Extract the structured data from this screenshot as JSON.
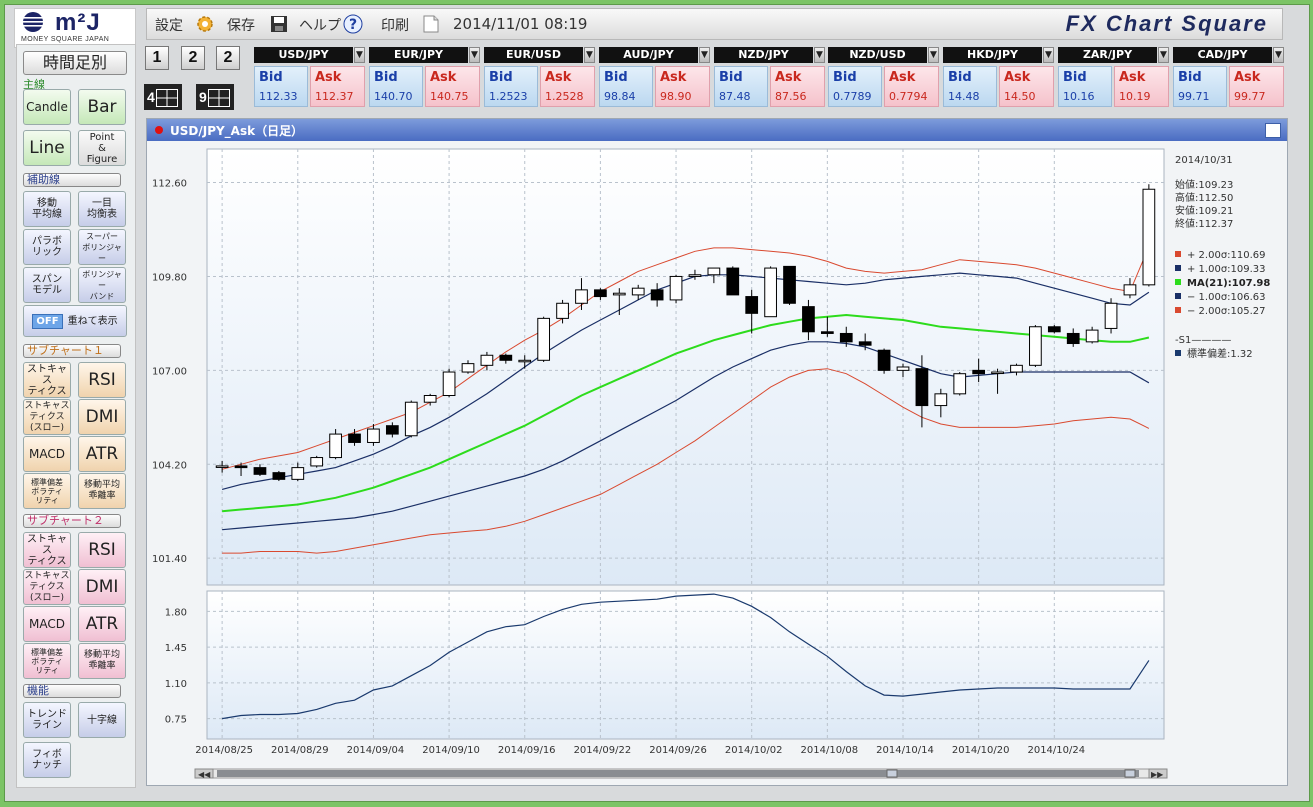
{
  "logo": {
    "brand": "m²J",
    "sub": "MONEY SQUARE JAPAN"
  },
  "toolbar": {
    "settings": "設定",
    "save": "保存",
    "help": "ヘルプ",
    "print": "印刷",
    "datetime": "2014/11/01 08:19",
    "brand": "FX Chart Square"
  },
  "layout_buttons": {
    "b1": "1",
    "b2": "2",
    "b3": "2",
    "b4": "4",
    "b9": "9"
  },
  "quotes": [
    {
      "pair": "USD/JPY",
      "bid_label": "Bid",
      "ask_label": "Ask",
      "bid": "112.33",
      "ask": "112.37"
    },
    {
      "pair": "EUR/JPY",
      "bid_label": "Bid",
      "ask_label": "Ask",
      "bid": "140.70",
      "ask": "140.75"
    },
    {
      "pair": "EUR/USD",
      "bid_label": "Bid",
      "ask_label": "Ask",
      "bid": "1.2523",
      "ask": "1.2528"
    },
    {
      "pair": "AUD/JPY",
      "bid_label": "Bid",
      "ask_label": "Ask",
      "bid": "98.84",
      "ask": "98.90"
    },
    {
      "pair": "NZD/JPY",
      "bid_label": "Bid",
      "ask_label": "Ask",
      "bid": "87.48",
      "ask": "87.56"
    },
    {
      "pair": "NZD/USD",
      "bid_label": "Bid",
      "ask_label": "Ask",
      "bid": "0.7789",
      "ask": "0.7794"
    },
    {
      "pair": "HKD/JPY",
      "bid_label": "Bid",
      "ask_label": "Ask",
      "bid": "14.48",
      "ask": "14.50"
    },
    {
      "pair": "ZAR/JPY",
      "bid_label": "Bid",
      "ask_label": "Ask",
      "bid": "10.16",
      "ask": "10.19"
    },
    {
      "pair": "CAD/JPY",
      "bid_label": "Bid",
      "ask_label": "Ask",
      "bid": "99.71",
      "ask": "99.77"
    }
  ],
  "sidebar": {
    "timeframe": "時間足別",
    "main_label": "主線",
    "candle": "Candle",
    "bar": "Bar",
    "line": "Line",
    "pf_1": "Point",
    "pf_2": "&",
    "pf_3": "Figure",
    "aux_label": "補助線",
    "ma_1": "移動",
    "ma_2": "平均線",
    "ichimoku_1": "一目",
    "ichimoku_2": "均衡表",
    "parabolic_1": "パラボ",
    "parabolic_2": "リック",
    "super_1": "スーパー",
    "super_2": "ボリンジャー",
    "span_1": "スパン",
    "span_2": "モデル",
    "bollinger_1": "ボリンジャー",
    "bollinger_2": "バンド",
    "off_tag": "OFF",
    "overlay": "重ねて表示",
    "sub1_label": "サブチャート１",
    "sub2_label": "サブチャート２",
    "stoch_1": "ストキャス",
    "stoch_2": "ティクス",
    "slow_1": "ストキャス",
    "slow_2": "ティクス",
    "slow_3": "(スロー)",
    "rsi": "RSI",
    "dmi": "DMI",
    "macd": "MACD",
    "atr": "ATR",
    "stdvol_1": "標準偏差",
    "stdvol_2": "ボラティ",
    "stdvol_3": "リティ",
    "madev_1": "移動平均",
    "madev_2": "乖離率",
    "func_label": "機能",
    "trend_1": "トレンド",
    "trend_2": "ライン",
    "crosshair": "十字線",
    "fibo_1": "フィボ",
    "fibo_2": "ナッチ"
  },
  "chart_window": {
    "title": "USD/JPY_Ask（日足）",
    "info": {
      "date": "2014/10/31",
      "open": "始値:109.23",
      "high": "高値:112.50",
      "low": "安値:109.21",
      "close": "終値:112.37",
      "bb_p2": "+ 2.00σ:110.69",
      "bb_p1": "+ 1.00σ:109.33",
      "ma": "MA(21):107.98",
      "bb_m1": "− 1.00σ:106.63",
      "bb_m2": "− 2.00σ:105.27",
      "s1": "-S1————",
      "std": "標準偏差:1.32"
    }
  },
  "colors": {
    "ma": "#2ddc1c",
    "bb_outer": "#d9492f",
    "bb_inner": "#1a2f66",
    "std": "#1a3a6e",
    "bid": "#1a3fa8",
    "ask": "#c9281e"
  },
  "chart_data": {
    "type": "candlestick",
    "main": {
      "y_ticks": [
        "112.60",
        "109.80",
        "107.00",
        "104.20",
        "101.40"
      ],
      "y_tick_values": [
        112.6,
        109.8,
        107.0,
        104.2,
        101.4
      ],
      "ylim": [
        100.6,
        113.6
      ],
      "x_tick_labels": [
        "2014/08/25",
        "2014/08/29",
        "2014/09/04",
        "2014/09/10",
        "2014/09/16",
        "2014/09/22",
        "2014/09/26",
        "2014/10/02",
        "2014/10/08",
        "2014/10/14",
        "2014/10/20",
        "2014/10/24"
      ],
      "x_tick_index": [
        0,
        4,
        8,
        12,
        16,
        20,
        24,
        28,
        32,
        36,
        40,
        44
      ],
      "candles": [
        {
          "o": 104.15,
          "h": 104.3,
          "l": 103.95,
          "c": 104.15
        },
        {
          "o": 104.15,
          "h": 104.25,
          "l": 103.85,
          "c": 104.1
        },
        {
          "o": 104.1,
          "h": 104.2,
          "l": 103.85,
          "c": 103.9
        },
        {
          "o": 103.95,
          "h": 104.0,
          "l": 103.7,
          "c": 103.75
        },
        {
          "o": 103.75,
          "h": 104.25,
          "l": 103.7,
          "c": 104.1
        },
        {
          "o": 104.15,
          "h": 104.45,
          "l": 104.1,
          "c": 104.4
        },
        {
          "o": 104.4,
          "h": 105.25,
          "l": 104.35,
          "c": 105.1
        },
        {
          "o": 105.1,
          "h": 105.25,
          "l": 104.75,
          "c": 104.85
        },
        {
          "o": 104.85,
          "h": 105.4,
          "l": 104.75,
          "c": 105.25
        },
        {
          "o": 105.35,
          "h": 105.45,
          "l": 105.0,
          "c": 105.1
        },
        {
          "o": 105.05,
          "h": 106.1,
          "l": 105.0,
          "c": 106.05
        },
        {
          "o": 106.05,
          "h": 106.3,
          "l": 105.95,
          "c": 106.25
        },
        {
          "o": 106.25,
          "h": 107.05,
          "l": 106.2,
          "c": 106.95
        },
        {
          "o": 106.95,
          "h": 107.3,
          "l": 106.9,
          "c": 107.2
        },
        {
          "o": 107.15,
          "h": 107.55,
          "l": 107.0,
          "c": 107.45
        },
        {
          "o": 107.45,
          "h": 107.5,
          "l": 107.2,
          "c": 107.3
        },
        {
          "o": 107.3,
          "h": 107.45,
          "l": 107.05,
          "c": 107.3
        },
        {
          "o": 107.3,
          "h": 108.6,
          "l": 107.25,
          "c": 108.55
        },
        {
          "o": 108.55,
          "h": 109.1,
          "l": 108.4,
          "c": 109.0
        },
        {
          "o": 109.0,
          "h": 109.75,
          "l": 108.8,
          "c": 109.4
        },
        {
          "o": 109.4,
          "h": 109.45,
          "l": 109.1,
          "c": 109.2
        },
        {
          "o": 109.25,
          "h": 109.45,
          "l": 108.65,
          "c": 109.3
        },
        {
          "o": 109.25,
          "h": 109.55,
          "l": 109.1,
          "c": 109.45
        },
        {
          "o": 109.4,
          "h": 109.6,
          "l": 108.9,
          "c": 109.1
        },
        {
          "o": 109.1,
          "h": 109.85,
          "l": 109.0,
          "c": 109.8
        },
        {
          "o": 109.8,
          "h": 110.0,
          "l": 109.7,
          "c": 109.85
        },
        {
          "o": 109.85,
          "h": 110.05,
          "l": 109.6,
          "c": 110.05
        },
        {
          "o": 110.05,
          "h": 110.1,
          "l": 109.3,
          "c": 109.25
        },
        {
          "o": 109.2,
          "h": 109.4,
          "l": 108.1,
          "c": 108.7
        },
        {
          "o": 108.6,
          "h": 110.1,
          "l": 108.6,
          "c": 110.05
        },
        {
          "o": 110.1,
          "h": 110.1,
          "l": 108.95,
          "c": 109.0
        },
        {
          "o": 108.9,
          "h": 109.1,
          "l": 107.9,
          "c": 108.15
        },
        {
          "o": 108.15,
          "h": 108.6,
          "l": 108.0,
          "c": 108.1
        },
        {
          "o": 108.1,
          "h": 108.3,
          "l": 107.7,
          "c": 107.85
        },
        {
          "o": 107.85,
          "h": 108.1,
          "l": 107.6,
          "c": 107.75
        },
        {
          "o": 107.6,
          "h": 107.65,
          "l": 106.9,
          "c": 107.0
        },
        {
          "o": 107.0,
          "h": 107.2,
          "l": 106.8,
          "c": 107.1
        },
        {
          "o": 107.05,
          "h": 107.45,
          "l": 105.3,
          "c": 105.95
        },
        {
          "o": 105.95,
          "h": 106.45,
          "l": 105.6,
          "c": 106.3
        },
        {
          "o": 106.3,
          "h": 106.95,
          "l": 106.25,
          "c": 106.9
        },
        {
          "o": 107.0,
          "h": 107.35,
          "l": 106.65,
          "c": 106.9
        },
        {
          "o": 106.95,
          "h": 107.05,
          "l": 106.3,
          "c": 106.95
        },
        {
          "o": 106.95,
          "h": 107.2,
          "l": 106.85,
          "c": 107.15
        },
        {
          "o": 107.15,
          "h": 108.35,
          "l": 107.1,
          "c": 108.3
        },
        {
          "o": 108.3,
          "h": 108.35,
          "l": 108.1,
          "c": 108.15
        },
        {
          "o": 108.1,
          "h": 108.25,
          "l": 107.7,
          "c": 107.8
        },
        {
          "o": 107.85,
          "h": 108.3,
          "l": 107.8,
          "c": 108.2
        },
        {
          "o": 108.25,
          "h": 109.15,
          "l": 108.1,
          "c": 109.0
        },
        {
          "o": 109.25,
          "h": 109.75,
          "l": 109.15,
          "c": 109.55
        },
        {
          "o": 109.55,
          "h": 112.55,
          "l": 109.5,
          "c": 112.4
        }
      ],
      "series": [
        {
          "name": "+ 2.00σ",
          "values": [
            104.05,
            104.2,
            104.35,
            104.45,
            104.55,
            104.75,
            104.95,
            105.15,
            105.35,
            105.55,
            105.75,
            106.05,
            106.35,
            106.75,
            107.15,
            107.55,
            107.9,
            108.2,
            108.55,
            108.95,
            109.35,
            109.65,
            109.95,
            110.15,
            110.35,
            110.55,
            110.65,
            110.65,
            110.6,
            110.55,
            110.5,
            110.4,
            110.25,
            110.05,
            109.95,
            109.9,
            109.95,
            110.0,
            110.15,
            110.3,
            110.25,
            110.2,
            110.15,
            110.05,
            109.9,
            109.75,
            109.6,
            109.45,
            109.35,
            110.69
          ]
        },
        {
          "name": "+ 1.00σ",
          "values": [
            103.45,
            103.6,
            103.7,
            103.8,
            103.9,
            104.0,
            104.1,
            104.3,
            104.5,
            104.75,
            105.05,
            105.3,
            105.6,
            105.95,
            106.3,
            106.7,
            107.1,
            107.5,
            107.85,
            108.2,
            108.5,
            108.8,
            109.1,
            109.4,
            109.6,
            109.8,
            109.85,
            109.85,
            109.8,
            109.75,
            109.7,
            109.65,
            109.6,
            109.55,
            109.6,
            109.7,
            109.75,
            109.8,
            109.85,
            109.9,
            109.85,
            109.8,
            109.75,
            109.6,
            109.45,
            109.3,
            109.15,
            109.0,
            108.95,
            109.33
          ]
        },
        {
          "name": "MA(21)",
          "values": [
            102.8,
            102.85,
            102.9,
            102.95,
            103.0,
            103.1,
            103.2,
            103.35,
            103.5,
            103.7,
            103.9,
            104.1,
            104.35,
            104.6,
            104.85,
            105.1,
            105.35,
            105.65,
            105.95,
            106.25,
            106.5,
            106.75,
            107.0,
            107.25,
            107.5,
            107.7,
            107.9,
            108.05,
            108.2,
            108.35,
            108.45,
            108.55,
            108.6,
            108.65,
            108.6,
            108.55,
            108.5,
            108.4,
            108.3,
            108.25,
            108.2,
            108.15,
            108.1,
            108.05,
            108.0,
            107.95,
            107.9,
            107.85,
            107.85,
            107.98
          ]
        },
        {
          "name": "− 1.00σ",
          "values": [
            102.25,
            102.3,
            102.35,
            102.4,
            102.45,
            102.5,
            102.55,
            102.6,
            102.7,
            102.8,
            102.95,
            103.1,
            103.25,
            103.4,
            103.55,
            103.7,
            103.85,
            104.05,
            104.3,
            104.6,
            104.9,
            105.2,
            105.5,
            105.8,
            106.1,
            106.45,
            106.8,
            107.1,
            107.35,
            107.6,
            107.75,
            107.85,
            107.85,
            107.8,
            107.7,
            107.5,
            107.3,
            107.1,
            106.9,
            106.8,
            106.85,
            106.9,
            106.95,
            106.95,
            106.95,
            106.95,
            106.95,
            106.95,
            106.95,
            106.63
          ]
        },
        {
          "name": "− 2.00σ",
          "values": [
            101.55,
            101.55,
            101.6,
            101.6,
            101.6,
            101.55,
            101.6,
            101.7,
            101.8,
            101.9,
            102.0,
            102.1,
            102.15,
            102.2,
            102.25,
            102.35,
            102.5,
            102.7,
            102.9,
            103.1,
            103.3,
            103.6,
            103.9,
            104.2,
            104.55,
            104.9,
            105.3,
            105.7,
            106.1,
            106.5,
            106.8,
            107.0,
            107.05,
            106.9,
            106.6,
            106.25,
            105.9,
            105.6,
            105.4,
            105.3,
            105.3,
            105.3,
            105.3,
            105.35,
            105.4,
            105.5,
            105.55,
            105.6,
            105.55,
            105.27
          ]
        }
      ]
    },
    "sub": {
      "type": "line",
      "y_ticks": [
        "1.80",
        "1.45",
        "1.10",
        "0.75"
      ],
      "y_tick_values": [
        1.8,
        1.45,
        1.1,
        0.75
      ],
      "ylim": [
        0.55,
        2.0
      ],
      "series": [
        {
          "name": "標準偏差",
          "values": [
            0.75,
            0.78,
            0.79,
            0.79,
            0.8,
            0.84,
            0.9,
            0.93,
            1.03,
            1.07,
            1.17,
            1.27,
            1.4,
            1.5,
            1.6,
            1.65,
            1.67,
            1.75,
            1.82,
            1.87,
            1.89,
            1.9,
            1.91,
            1.92,
            1.95,
            1.96,
            1.97,
            1.93,
            1.85,
            1.74,
            1.6,
            1.48,
            1.36,
            1.21,
            1.07,
            0.98,
            0.97,
            0.99,
            1.01,
            1.03,
            1.04,
            1.05,
            1.05,
            1.05,
            1.05,
            1.04,
            1.04,
            1.04,
            1.04,
            1.32
          ]
        }
      ]
    }
  }
}
